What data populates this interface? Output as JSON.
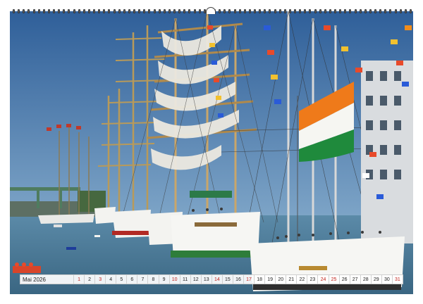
{
  "calendar": {
    "month_label": "Mai 2026",
    "days": [
      {
        "n": "1",
        "red": true
      },
      {
        "n": "2",
        "red": false
      },
      {
        "n": "3",
        "red": true
      },
      {
        "n": "4",
        "red": false
      },
      {
        "n": "5",
        "red": false
      },
      {
        "n": "6",
        "red": false
      },
      {
        "n": "7",
        "red": false
      },
      {
        "n": "8",
        "red": false
      },
      {
        "n": "9",
        "red": false
      },
      {
        "n": "10",
        "red": true
      },
      {
        "n": "11",
        "red": false
      },
      {
        "n": "12",
        "red": false
      },
      {
        "n": "13",
        "red": false
      },
      {
        "n": "14",
        "red": true
      },
      {
        "n": "15",
        "red": false
      },
      {
        "n": "16",
        "red": false
      },
      {
        "n": "17",
        "red": true
      },
      {
        "n": "18",
        "red": false
      },
      {
        "n": "19",
        "red": false
      },
      {
        "n": "20",
        "red": false
      },
      {
        "n": "21",
        "red": false
      },
      {
        "n": "22",
        "red": false
      },
      {
        "n": "23",
        "red": false
      },
      {
        "n": "24",
        "red": true
      },
      {
        "n": "25",
        "red": true
      },
      {
        "n": "26",
        "red": false
      },
      {
        "n": "27",
        "red": false
      },
      {
        "n": "28",
        "red": false
      },
      {
        "n": "29",
        "red": false
      },
      {
        "n": "30",
        "red": false
      },
      {
        "n": "31",
        "red": true
      }
    ]
  },
  "photo": {
    "subject": "tall-ships-harbor",
    "colors": {
      "sky": "#3f6fa6",
      "water": "#4a7a9c",
      "hull_white": "#f3f3f0",
      "hull_green": "#2e7d3a",
      "flag_orange": "#ef7a1a",
      "flag_green": "#1f8a3c"
    }
  }
}
